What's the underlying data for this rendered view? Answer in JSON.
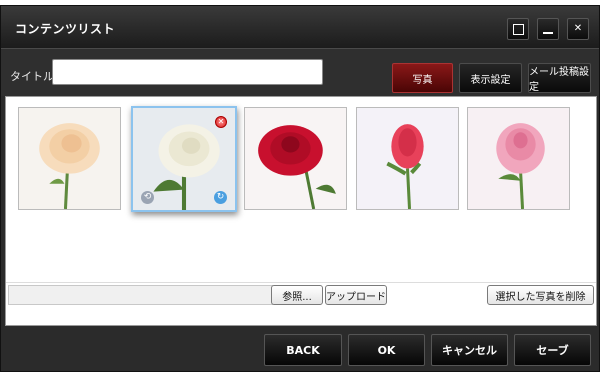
{
  "window": {
    "title": "コンテンツリスト",
    "controls": [
      "maximize-icon",
      "minimize-icon",
      "close-icon"
    ]
  },
  "toolbar": {
    "title_label": "タイトル:",
    "title_value": "",
    "tabs": [
      {
        "label": "写真",
        "active": true
      },
      {
        "label": "表示設定",
        "active": false
      },
      {
        "label": "メール投稿設定",
        "active": false
      }
    ]
  },
  "gallery": {
    "photos": [
      {
        "subject": "peach rose",
        "selected": false
      },
      {
        "subject": "white rose",
        "selected": true
      },
      {
        "subject": "red rose",
        "selected": false
      },
      {
        "subject": "coral rose bud",
        "selected": false
      },
      {
        "subject": "pink rose",
        "selected": false
      }
    ]
  },
  "upload": {
    "file_value": "",
    "browse_label": "参照...",
    "upload_label": "アップロード",
    "delete_label": "選択した写真を削除"
  },
  "footer": {
    "back_label": "BACK",
    "ok_label": "OK",
    "cancel_label": "キャンセル",
    "save_label": "セーブ"
  },
  "colors": {
    "chrome_dark": "#1c1c1c",
    "active_tab": "#6a0e0e",
    "selection_border": "#8cc3ee"
  }
}
